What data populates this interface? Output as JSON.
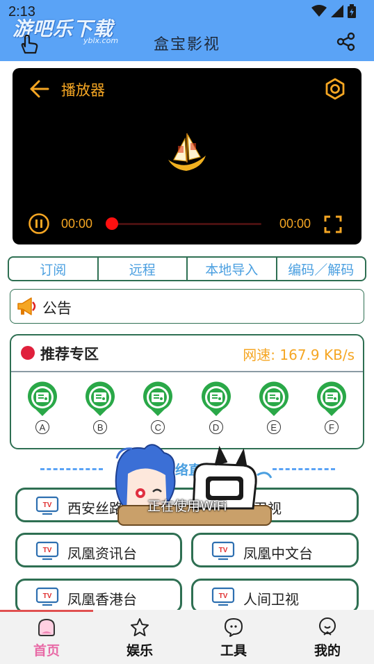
{
  "status_bar": {
    "time": "2:13"
  },
  "header": {
    "watermark": "游吧乐下载",
    "watermark_sub": "yblx.com",
    "title": "盒宝影视"
  },
  "player": {
    "title": "播放器",
    "current_time": "00:00",
    "duration": "00:00",
    "progress": 0,
    "accent_color": "#f5a623"
  },
  "tabs": [
    {
      "label": "订阅"
    },
    {
      "label": "远程"
    },
    {
      "label": "本地导入"
    },
    {
      "label": "编码／解码"
    }
  ],
  "notice": {
    "label": "公告"
  },
  "recommended": {
    "title": "推荐专区",
    "speed": "网速: 167.9 KB/s",
    "items": [
      {
        "label": "A"
      },
      {
        "label": "B"
      },
      {
        "label": "C"
      },
      {
        "label": "D"
      },
      {
        "label": "E"
      },
      {
        "label": "F"
      }
    ]
  },
  "live": {
    "title": "网络直播",
    "channels": [
      {
        "name": "西安丝路"
      },
      {
        "name": "星空卫视"
      },
      {
        "name": "凤凰资讯台"
      },
      {
        "name": "凤凰中文台"
      },
      {
        "name": "凤凰香港台"
      },
      {
        "name": "人间卫视"
      }
    ]
  },
  "toast": "正在使用WiFi",
  "nav": [
    {
      "label": "首页",
      "icon": "home-icon",
      "active": true
    },
    {
      "label": "娱乐",
      "icon": "star-icon"
    },
    {
      "label": "工具",
      "icon": "chat-icon"
    },
    {
      "label": "我的",
      "icon": "profile-icon"
    }
  ],
  "colors": {
    "header": "#5aa3f6",
    "border": "#2e6f52",
    "accent": "#f5a623",
    "tab_text": "#4a9fe0",
    "nav_active": "#e86aa6"
  }
}
